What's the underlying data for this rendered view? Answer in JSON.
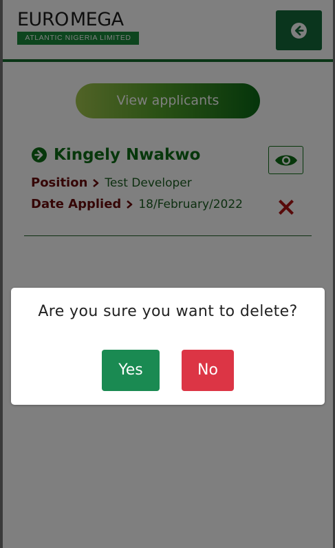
{
  "header": {
    "logo_word_1": "EURO",
    "logo_word_2": "MEGA",
    "logo_subtitle": "ATLANTIC NIGERIA LIMITED",
    "back_icon": "arrow-left-circle-icon"
  },
  "main": {
    "view_applicants_label": "View applicants",
    "applicant": {
      "name": "Kingely Nwakwo",
      "position_label": "Position",
      "position_value": "Test Developer",
      "date_label": "Date Applied",
      "date_value": "18/February/2022",
      "view_icon": "eye-icon",
      "delete_icon": "close-x-icon"
    }
  },
  "dialog": {
    "message": "Are you sure you want to delete?",
    "yes_label": "Yes",
    "no_label": "No"
  },
  "colors": {
    "brand_green": "#146b3a",
    "logo_green": "#1a8a3c",
    "label_maroon": "#6b0d0d",
    "yes_green": "#1a8a52",
    "no_red": "#dc3545",
    "delete_red": "#b01515"
  }
}
